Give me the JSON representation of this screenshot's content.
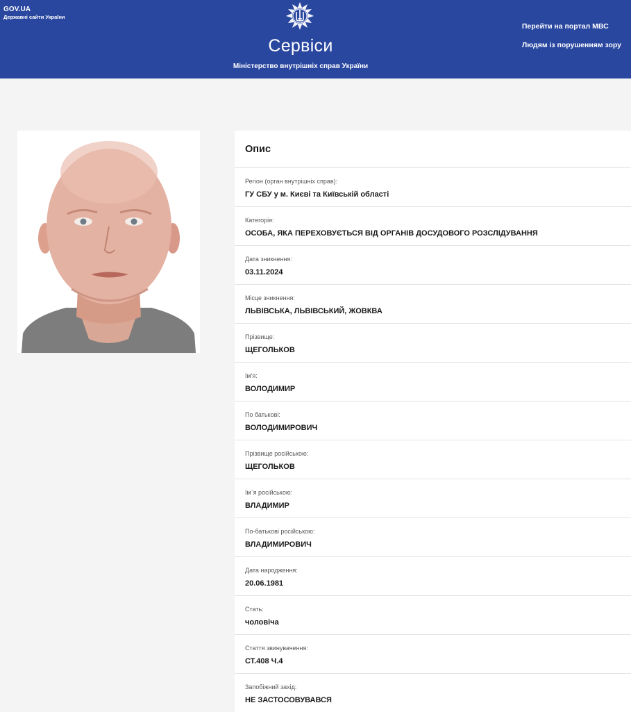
{
  "header": {
    "gov_name": "GOV.UA",
    "gov_subtitle": "Державні сайти України",
    "title": "Сервіси",
    "ministry": "Міністерство внутрішніх справ України",
    "links": [
      "Перейти на портал МВС",
      "Людям із порушенням зору"
    ]
  },
  "colors": {
    "header_bg": "#2a47a0",
    "page_bg": "#f4f4f4",
    "card_bg": "#ffffff"
  },
  "card": {
    "title": "Опис",
    "fields": [
      {
        "label": "Регіон (орган внутрішніх справ):",
        "value": "ГУ СБУ у м. Києві та Київській області"
      },
      {
        "label": "Категорія:",
        "value": "ОСОБА, ЯКА ПЕРЕХОВУЄТЬСЯ ВІД ОРГАНІВ ДОСУДОВОГО РОЗСЛІДУВАННЯ"
      },
      {
        "label": "Дата зникнення:",
        "value": "03.11.2024"
      },
      {
        "label": "Місце зникнення:",
        "value": "ЛЬВІВСЬКА, ЛЬВІВСЬКИЙ, ЖОВКВА"
      },
      {
        "label": "Прізвище:",
        "value": "ЩЕГОЛЬКОВ"
      },
      {
        "label": "Ім'я:",
        "value": "ВОЛОДИМИР"
      },
      {
        "label": "По батькові:",
        "value": "ВОЛОДИМИРОВИЧ"
      },
      {
        "label": "Прізвище російською:",
        "value": "ЩЕГОЛЬКОВ"
      },
      {
        "label": "Ім`я російською:",
        "value": "ВЛАДИМИР"
      },
      {
        "label": "По-батькові російською:",
        "value": "ВЛАДИМИРОВИЧ"
      },
      {
        "label": "Дата народження:",
        "value": "20.06.1981"
      },
      {
        "label": "Стать:",
        "value": "чоловіча"
      },
      {
        "label": "Стаття звинувачення:",
        "value": "СТ.408 Ч.4"
      },
      {
        "label": "Запобіжний захід:",
        "value": "НЕ ЗАСТОСОВУВАВСЯ"
      }
    ]
  }
}
